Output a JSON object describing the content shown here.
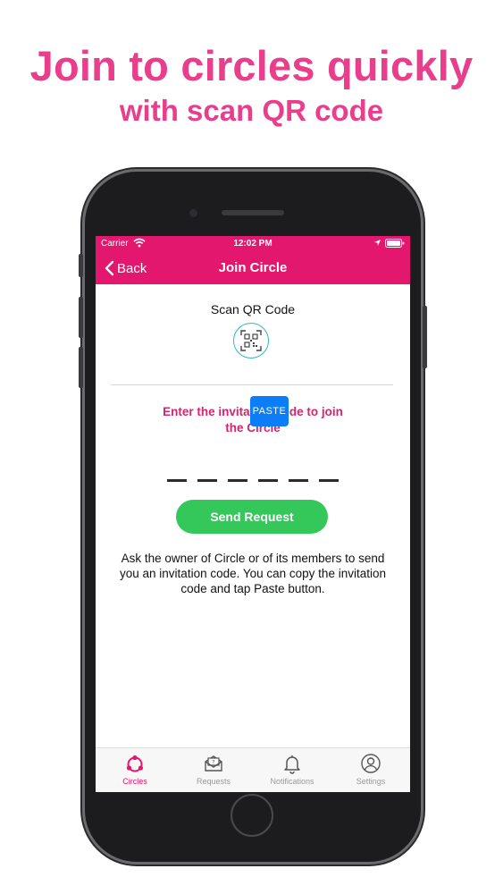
{
  "promo": {
    "title": "Join to circles quickly",
    "subtitle": "with scan QR code"
  },
  "status_bar": {
    "carrier": "Carrier",
    "time": "12:02 PM"
  },
  "nav": {
    "back_label": "Back",
    "title": "Join Circle"
  },
  "scan": {
    "label": "Scan QR Code",
    "icon": "qr-code-icon"
  },
  "invite": {
    "heading": "Enter the invitation code to join the Circle",
    "slot_count": 6,
    "paste_label": "PASTE"
  },
  "send_button_label": "Send Request",
  "instructions": "Ask the owner of Circle or of its members to send you an invitation code. You can copy the invitation code and tap Paste button.",
  "tabs": [
    {
      "label": "Circles",
      "icon": "circles-icon",
      "active": true
    },
    {
      "label": "Requests",
      "icon": "requests-icon",
      "active": false
    },
    {
      "label": "Notifications",
      "icon": "bell-icon",
      "active": false
    },
    {
      "label": "Settings",
      "icon": "user-icon",
      "active": false
    }
  ],
  "colors": {
    "promo_pink": "#e83e8c",
    "header_pink": "#e3176d",
    "send_green": "#34c759",
    "paste_blue": "#0a7df7",
    "qr_teal": "#2eb6c9"
  }
}
